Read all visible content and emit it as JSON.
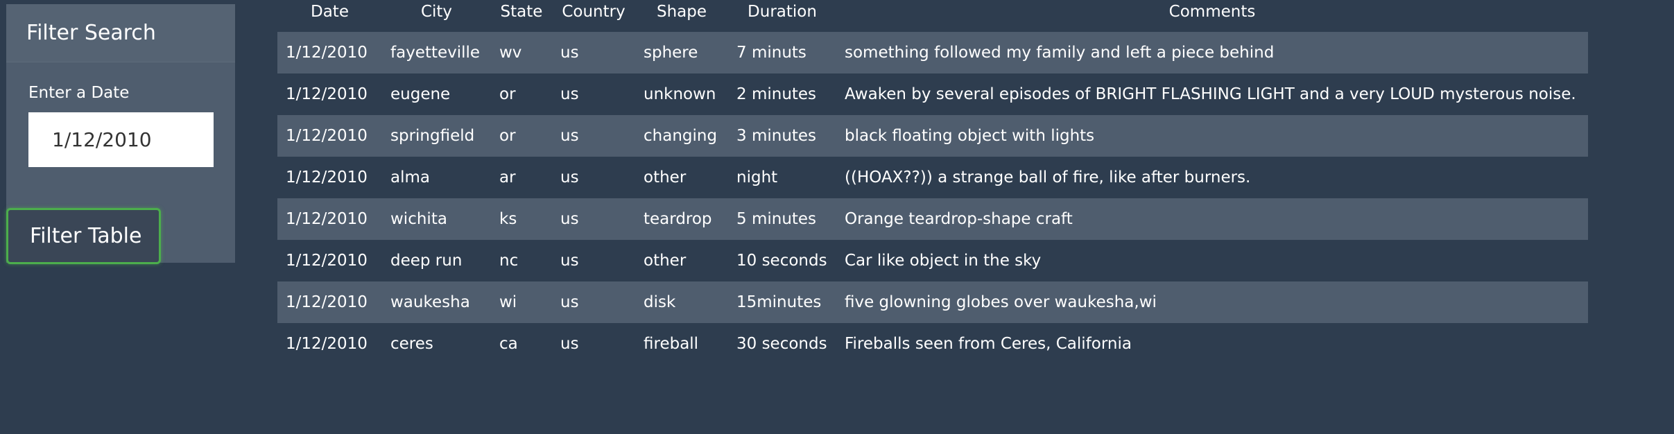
{
  "sidebar": {
    "title": "Filter Search",
    "date_label": "Enter a Date",
    "date_value": "1/12/2010",
    "filter_button_label": "Filter Table"
  },
  "table": {
    "headers": [
      "Date",
      "City",
      "State",
      "Country",
      "Shape",
      "Duration",
      "Comments"
    ],
    "rows": [
      [
        "1/12/2010",
        "fayetteville",
        "wv",
        "us",
        "sphere",
        "7 minuts",
        "something followed my family and left a piece behind"
      ],
      [
        "1/12/2010",
        "eugene",
        "or",
        "us",
        "unknown",
        "2 minutes",
        "Awaken by several episodes of BRIGHT FLASHING LIGHT and a very LOUD mysterous noise."
      ],
      [
        "1/12/2010",
        "springfield",
        "or",
        "us",
        "changing",
        "3 minutes",
        "black floating object with lights"
      ],
      [
        "1/12/2010",
        "alma",
        "ar",
        "us",
        "other",
        "night",
        "((HOAX??)) a strange ball of fire, like after burners."
      ],
      [
        "1/12/2010",
        "wichita",
        "ks",
        "us",
        "teardrop",
        "5 minutes",
        "Orange teardrop-shape craft"
      ],
      [
        "1/12/2010",
        "deep run",
        "nc",
        "us",
        "other",
        "10 seconds",
        "Car like object in the sky"
      ],
      [
        "1/12/2010",
        "waukesha",
        "wi",
        "us",
        "disk",
        "15minutes",
        "five glowning globes over waukesha,wi"
      ],
      [
        "1/12/2010",
        "ceres",
        "ca",
        "us",
        "fireball",
        "30 seconds",
        "Fireballs seen from Ceres, California"
      ]
    ]
  },
  "colors": {
    "page_background": "#2e3d4f",
    "panel_background": "#4f5d6e",
    "striped_row": "#4f5d6e",
    "button_border": "#4cae4c",
    "text": "#ffffff"
  }
}
